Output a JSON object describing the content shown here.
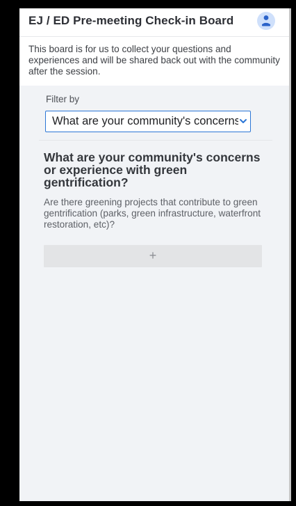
{
  "header": {
    "title": "EJ / ED Pre-meeting Check-in Board",
    "avatar_icon": "person-icon"
  },
  "board": {
    "description": "This board is for us to collect your questions and experiences and will be shared back out with the community after the session."
  },
  "filter": {
    "label": "Filter by",
    "selected": "What are your community's concerns or experience with green gentrification?",
    "chevron_icon": "chevron-down-icon"
  },
  "question": {
    "title": "What are your community's concerns or experience with green gentrification?",
    "description": "Are there greening projects that contribute to green gentrification (parks, green infrastructure, waterfront restoration, etc)?",
    "add_label": "+"
  },
  "colors": {
    "accent": "#2b76d6",
    "page_background": "#f1f3f6",
    "avatar": "#2b63c9"
  }
}
